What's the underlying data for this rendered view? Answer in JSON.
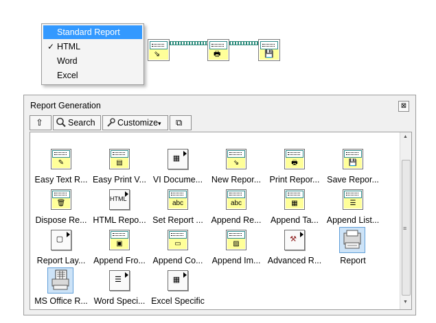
{
  "menu": {
    "items": [
      {
        "label": "Standard Report",
        "checked": false,
        "highlighted": true
      },
      {
        "label": "HTML",
        "checked": true,
        "highlighted": false
      },
      {
        "label": "Word",
        "checked": false,
        "highlighted": false
      },
      {
        "label": "Excel",
        "checked": false,
        "highlighted": false
      }
    ],
    "check_mark": "✓"
  },
  "diagram": {
    "nodes": [
      {
        "name": "new-report-node",
        "glyph": "⇘"
      },
      {
        "name": "print-report-node",
        "glyph": "🖶"
      },
      {
        "name": "save-report-node",
        "glyph": "💾"
      }
    ],
    "wire_color": "#2a8a7a"
  },
  "palette": {
    "title": "Report Generation",
    "close_glyph": "⊠",
    "toolbar": {
      "up_glyph": "⇧",
      "search_label": "Search",
      "customize_label": "Customize",
      "customize_arrow": "▾",
      "restore_glyph": "⧉"
    },
    "items": [
      {
        "label": "Easy Text R...",
        "kind": "vi",
        "glyph": "✎"
      },
      {
        "label": "Easy Print V...",
        "kind": "vi",
        "glyph": "▤"
      },
      {
        "label": "VI Docume...",
        "kind": "sub",
        "glyph": "▦"
      },
      {
        "label": "New Repor...",
        "kind": "vi",
        "glyph": "⇘"
      },
      {
        "label": "Print Repor...",
        "kind": "vi",
        "glyph": "🖶"
      },
      {
        "label": "Save Repor...",
        "kind": "vi",
        "glyph": "💾"
      },
      {
        "label": "Dispose Re...",
        "kind": "vi",
        "glyph": "🗑"
      },
      {
        "label": "HTML Repo...",
        "kind": "sub",
        "glyph": "HTML"
      },
      {
        "label": "Set Report ...",
        "kind": "vi",
        "glyph": "abc"
      },
      {
        "label": "Append Re...",
        "kind": "vi",
        "glyph": "abc"
      },
      {
        "label": "Append Ta...",
        "kind": "vi",
        "glyph": "▦"
      },
      {
        "label": "Append List...",
        "kind": "vi",
        "glyph": "☰"
      },
      {
        "label": "Report Lay...",
        "kind": "sub",
        "glyph": "▢"
      },
      {
        "label": "Append Fro...",
        "kind": "vi",
        "glyph": "▣"
      },
      {
        "label": "Append Co...",
        "kind": "vi",
        "glyph": "▭"
      },
      {
        "label": "Append Im...",
        "kind": "vi",
        "glyph": "▨"
      },
      {
        "label": "Advanced R...",
        "kind": "sub",
        "glyph": "⚒"
      },
      {
        "label": "Report",
        "kind": "selected",
        "glyph": "🖶"
      },
      {
        "label": "MS Office R...",
        "kind": "selected",
        "glyph": "▦"
      },
      {
        "label": "Word Speci...",
        "kind": "sub",
        "glyph": "☰"
      },
      {
        "label": "Excel Specific",
        "kind": "sub",
        "glyph": "▦"
      }
    ],
    "scroll": {
      "up_arrow": "▲",
      "down_arrow": "▼",
      "grip": "≡"
    }
  }
}
